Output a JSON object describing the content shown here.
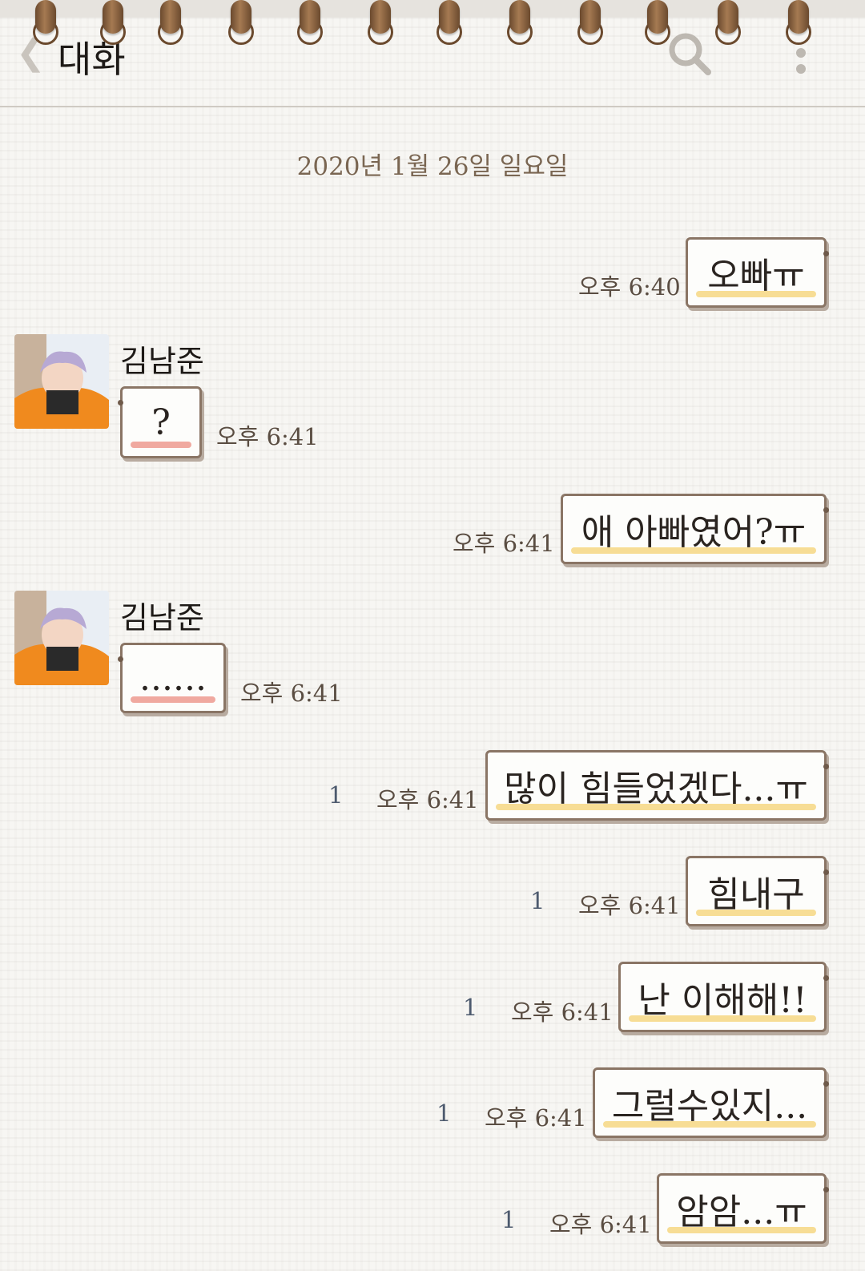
{
  "header": {
    "back_icon": "chevron-left-icon",
    "title": "대화",
    "search_icon": "search-icon",
    "more_icon": "more-vertical-icon"
  },
  "date_divider": "2020년 1월 26일 일요일",
  "colors": {
    "bubble_border": "#8a7565",
    "mine_underline": "#f7dd95",
    "theirs_underline": "#f0a9a0",
    "ring": "#8a6240"
  },
  "messages": [
    {
      "side": "mine",
      "text": "오빠ㅠ",
      "time": "오후 6:40",
      "unread": ""
    },
    {
      "side": "theirs",
      "sender": "김남준",
      "text": "?",
      "time": "오후 6:41"
    },
    {
      "side": "mine",
      "text": "애 아빠였어?ㅠ",
      "time": "오후 6:41",
      "unread": ""
    },
    {
      "side": "theirs",
      "sender": "김남준",
      "text": "......",
      "time": "오후 6:41"
    },
    {
      "side": "mine",
      "text": "많이 힘들었겠다...ㅠ",
      "time": "오후 6:41",
      "unread": "1"
    },
    {
      "side": "mine",
      "text": "힘내구",
      "time": "오후 6:41",
      "unread": "1"
    },
    {
      "side": "mine",
      "text": "난 이해해!!",
      "time": "오후 6:41",
      "unread": "1"
    },
    {
      "side": "mine",
      "text": "그럴수있지...",
      "time": "오후 6:41",
      "unread": "1"
    },
    {
      "side": "mine",
      "text": "암암...ㅠ",
      "time": "오후 6:41",
      "unread": "1"
    }
  ]
}
